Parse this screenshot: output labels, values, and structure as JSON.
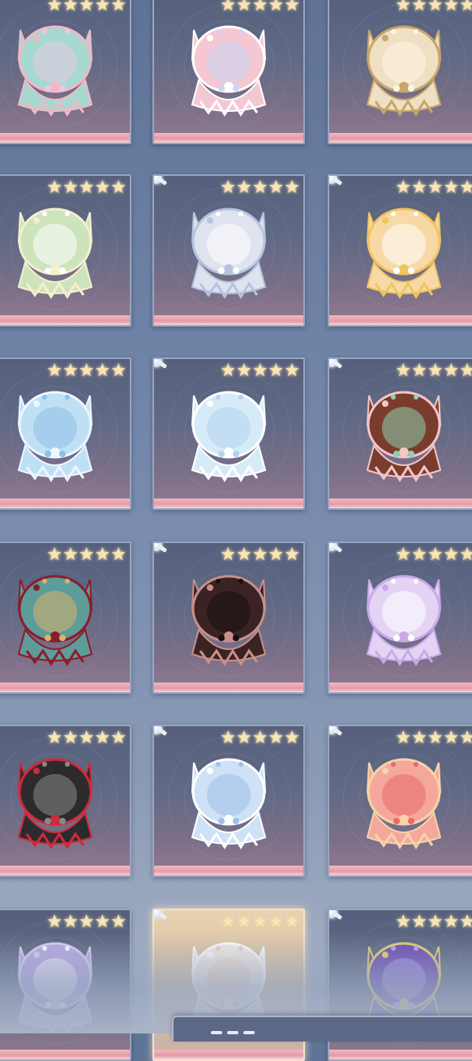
{
  "grid": {
    "cards": [
      {
        "id": "teal-flower-hood",
        "rarity": 5,
        "stars": "★★★★★",
        "colors": {
          "hood": "#a7d9d0",
          "trim": "#f3b7c6",
          "accent": "#e8c9e0"
        },
        "pin": false,
        "selected": false
      },
      {
        "id": "pink-cat-hood",
        "rarity": 5,
        "stars": "★★★★★",
        "colors": {
          "hood": "#f5c7d3",
          "trim": "#ffffff",
          "accent": "#c9d6f2"
        },
        "pin": false,
        "selected": false
      },
      {
        "id": "cream-cat-hood",
        "rarity": 5,
        "stars": "★★★★★",
        "colors": {
          "hood": "#efe0c4",
          "trim": "#c9a56b",
          "accent": "#fff5e4"
        },
        "pin": false,
        "selected": false
      },
      {
        "id": "mint-flower-hood",
        "rarity": 5,
        "stars": "★★★★★",
        "colors": {
          "hood": "#cde3bc",
          "trim": "#f4efcf",
          "accent": "#ffffff"
        },
        "pin": false,
        "selected": false
      },
      {
        "id": "silver-cat-hood",
        "rarity": 5,
        "stars": "★★★★★",
        "colors": {
          "hood": "#dfe3ee",
          "trim": "#b6c3e0",
          "accent": "#ffffff"
        },
        "pin": true,
        "selected": false
      },
      {
        "id": "golden-cat-hood",
        "rarity": 5,
        "stars": "★★★★★",
        "colors": {
          "hood": "#f7d9a6",
          "trim": "#f0c45f",
          "accent": "#ffffff"
        },
        "pin": true,
        "selected": false
      },
      {
        "id": "skyblue-lace-hood",
        "rarity": 5,
        "stars": "★★★★★",
        "colors": {
          "hood": "#bfe0f4",
          "trim": "#eef6ff",
          "accent": "#8fbfe6"
        },
        "pin": false,
        "selected": false
      },
      {
        "id": "ice-crystal-hood",
        "rarity": 5,
        "stars": "★★★★★",
        "colors": {
          "hood": "#d6ebf8",
          "trim": "#ffffff",
          "accent": "#b5d3ee"
        },
        "pin": true,
        "selected": false
      },
      {
        "id": "chocolate-party-hood",
        "rarity": 5,
        "stars": "★★★★★",
        "colors": {
          "hood": "#7a3c2c",
          "trim": "#f3c6c8",
          "accent": "#8bd1b3"
        },
        "pin": true,
        "selected": false
      },
      {
        "id": "teal-crimson-hood",
        "rarity": 5,
        "stars": "★★★★★",
        "colors": {
          "hood": "#5e9c9a",
          "trim": "#8c1c2a",
          "accent": "#d9b36b"
        },
        "pin": false,
        "selected": false
      },
      {
        "id": "dark-raven-hood",
        "rarity": 5,
        "stars": "★★★★★",
        "colors": {
          "hood": "#3b2324",
          "trim": "#c98f8a",
          "accent": "#151010"
        },
        "pin": true,
        "selected": false
      },
      {
        "id": "lilac-flower-hood",
        "rarity": 5,
        "stars": "★★★★★",
        "colors": {
          "hood": "#e4d4f4",
          "trim": "#c9a9ea",
          "accent": "#ffffff"
        },
        "pin": true,
        "selected": false
      },
      {
        "id": "black-gothic-hood",
        "rarity": 5,
        "stars": "★★★★★",
        "colors": {
          "hood": "#2d2a2e",
          "trim": "#d02a3a",
          "accent": "#8a8a8a"
        },
        "pin": false,
        "selected": false
      },
      {
        "id": "frost-butterfly-hood",
        "rarity": 5,
        "stars": "★★★★★",
        "colors": {
          "hood": "#cfe1f7",
          "trim": "#ffffff",
          "accent": "#9fc0ea"
        },
        "pin": true,
        "selected": false
      },
      {
        "id": "coral-blossom-hood",
        "rarity": 5,
        "stars": "★★★★★",
        "colors": {
          "hood": "#f4a89b",
          "trim": "#f7d3a8",
          "accent": "#e86a6a"
        },
        "pin": true,
        "selected": false
      },
      {
        "id": "lavender-bow-hood",
        "rarity": 5,
        "stars": "★★★★★",
        "colors": {
          "hood": "#b9a6e4",
          "trim": "#d9ccf4",
          "accent": "#ffffff"
        },
        "pin": false,
        "selected": false
      },
      {
        "id": "white-moon-hood",
        "rarity": 5,
        "stars": "★★★★★",
        "colors": {
          "hood": "#f4ece6",
          "trim": "#ffffff",
          "accent": "#f0d3c3"
        },
        "pin": true,
        "selected": true
      },
      {
        "id": "purple-star-hood",
        "rarity": 5,
        "stars": "★★★★★",
        "colors": {
          "hood": "#6d4bb3",
          "trim": "#e6d26a",
          "accent": "#b39cf0"
        },
        "pin": true,
        "selected": false
      }
    ]
  },
  "footer": {
    "panel": "item-detail-panel"
  }
}
